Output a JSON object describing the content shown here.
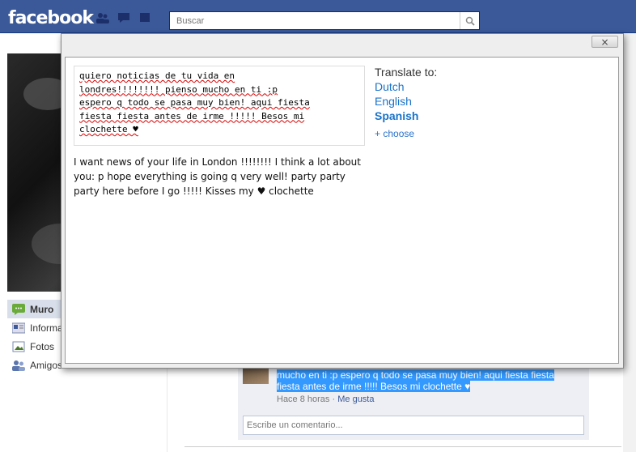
{
  "header": {
    "logo": "facebook",
    "search_placeholder": "Buscar",
    "icons": [
      "friend-requests-icon",
      "messages-icon",
      "notifications-icon"
    ]
  },
  "sidebar": {
    "items": [
      {
        "label": "Muro",
        "icon": "wall-icon",
        "selected": true
      },
      {
        "label": "Información",
        "icon": "info-icon"
      },
      {
        "label": "Fotos",
        "icon": "photos-icon"
      },
      {
        "label": "Amigos",
        "icon": "friends-icon"
      }
    ]
  },
  "translate_dialog": {
    "close_label": "×",
    "original_lines": [
      "quiero noticias de tu vida en",
      "londres!!!!!!!! pienso mucho en ti :p",
      "espero q todo se pasa muy bien! aqui fiesta",
      "fiesta fiesta antes de irme !!!!! Besos mi",
      "clochette ♥"
    ],
    "translation": "I want news of your life in London !!!!!!!! I think a lot about you: p hope everything is going q very well! party party party here before I go !!!!! Kisses my ♥ clochette",
    "translate_to_label": "Translate to:",
    "languages": [
      {
        "label": "Dutch",
        "active": false
      },
      {
        "label": "English",
        "active": false
      },
      {
        "label": "Spanish",
        "active": true
      }
    ],
    "choose_label": "+ choose"
  },
  "comment": {
    "text_line1": "mucho en ti :p espero q todo se pasa muy bien! aqui fiesta fiesta",
    "text_line2": "fiesta antes de irme !!!!! Besos mi clochette ♥",
    "time": "Hace 8 horas",
    "separator": "·",
    "like_label": "Me gusta",
    "input_placeholder": "Escribe un comentario..."
  },
  "colors": {
    "brand": "#3b5998",
    "link": "#1a73c9",
    "highlight": "#3399ff"
  }
}
